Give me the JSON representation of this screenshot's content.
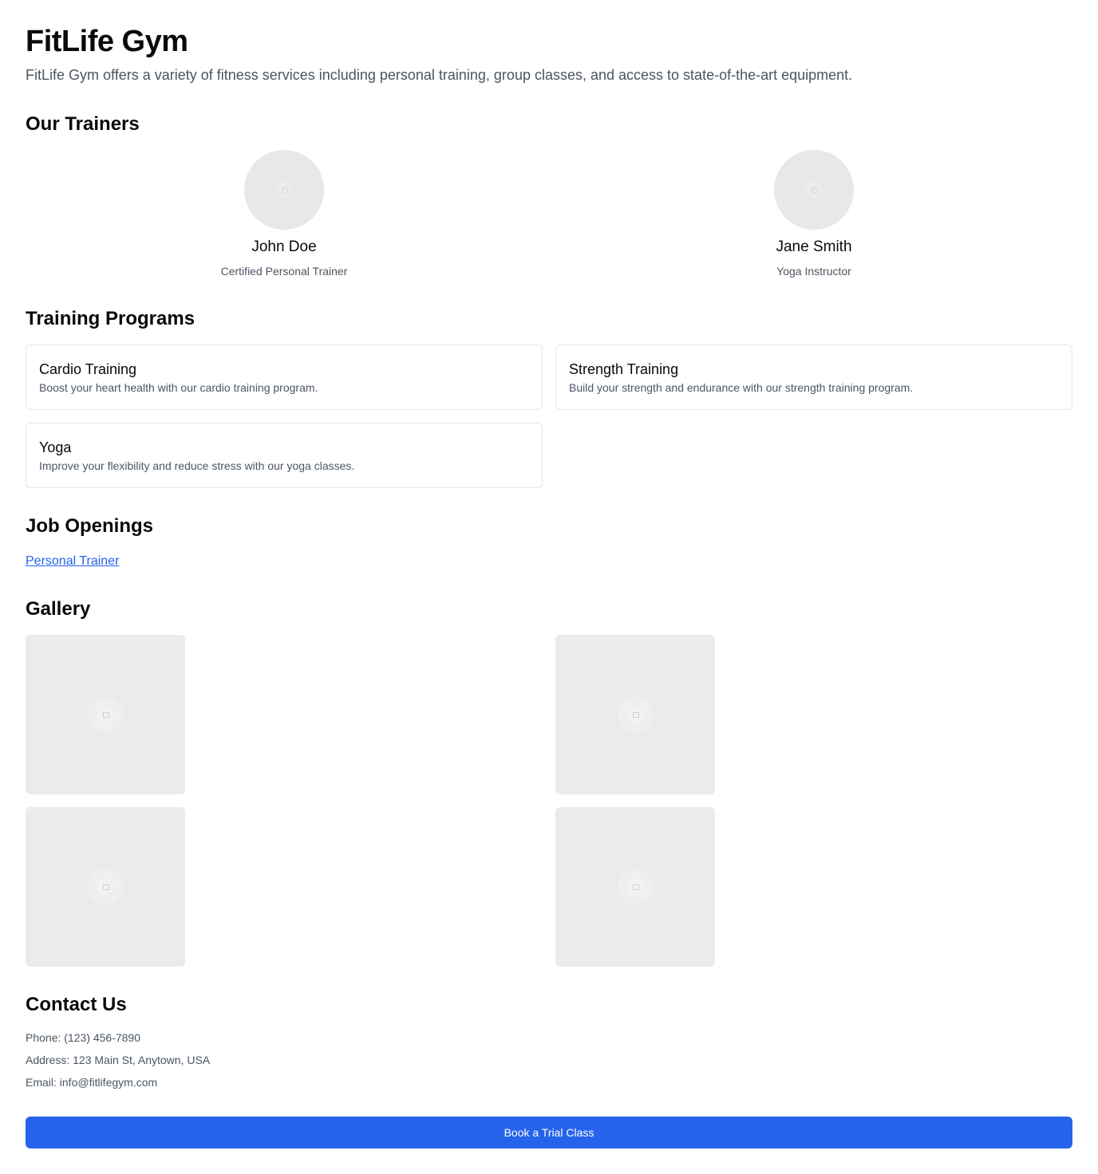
{
  "header": {
    "title": "FitLife Gym",
    "description": "FitLife Gym offers a variety of fitness services including personal training, group classes, and access to state-of-the-art equipment."
  },
  "trainers": {
    "heading": "Our Trainers",
    "items": [
      {
        "name": "John Doe",
        "role": "Certified Personal Trainer"
      },
      {
        "name": "Jane Smith",
        "role": "Yoga Instructor"
      }
    ]
  },
  "programs": {
    "heading": "Training Programs",
    "items": [
      {
        "title": "Cardio Training",
        "description": "Boost your heart health with our cardio training program."
      },
      {
        "title": "Strength Training",
        "description": "Build your strength and endurance with our strength training program."
      },
      {
        "title": "Yoga",
        "description": "Improve your flexibility and reduce stress with our yoga classes."
      }
    ]
  },
  "jobs": {
    "heading": "Job Openings",
    "items": [
      {
        "label": "Personal Trainer"
      }
    ]
  },
  "gallery": {
    "heading": "Gallery",
    "image_icon": "image-placeholder-icon"
  },
  "contact": {
    "heading": "Contact Us",
    "phone": "Phone: (123) 456-7890",
    "address": "Address: 123 Main St, Anytown, USA",
    "email": "Email: info@fitlifegym.com"
  },
  "cta": {
    "label": "Book a Trial Class"
  },
  "colors": {
    "accent": "#2563eb",
    "muted_text": "#4b5563",
    "placeholder_bg": "#ebebeb",
    "card_border": "#e5e7eb"
  }
}
